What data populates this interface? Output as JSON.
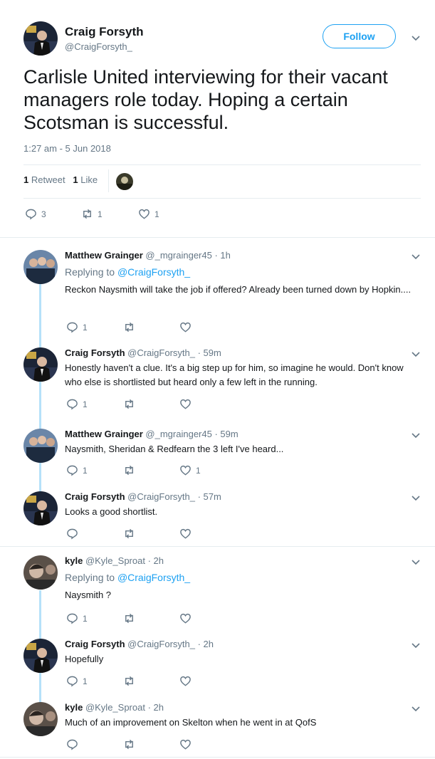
{
  "tweet": {
    "name": "Craig Forsyth",
    "handle": "@CraigForsyth_",
    "follow_label": "Follow",
    "text": "Carlisle United interviewing for their vacant managers role today. Hoping a certain Scotsman is successful.",
    "time": "1:27 am - 5 Jun 2018",
    "retweets_count": "1",
    "retweets_label": "Retweet",
    "likes_count": "1",
    "likes_label": "Like",
    "actions": {
      "replies": "3",
      "retweets": "1",
      "likes": "1"
    }
  },
  "replies": [
    {
      "name": "Matthew Grainger",
      "handle": "@_mgrainger45",
      "time": "· 1h",
      "replying_prefix": "Replying to ",
      "replying_to": "@CraigForsyth_",
      "text": "Reckon Naysmith will take the job if offered? Already been turned down by Hopkin....",
      "reply_count": "1",
      "retweet_count": "",
      "like_count": ""
    },
    {
      "name": "Craig Forsyth",
      "handle": "@CraigForsyth_",
      "time": "· 59m",
      "text": "Honestly haven't a clue. It's a big step up for him, so imagine he would. Don't know who else is shortlisted but heard only a few left in the running.",
      "reply_count": "1",
      "retweet_count": "",
      "like_count": ""
    },
    {
      "name": "Matthew Grainger",
      "handle": "@_mgrainger45",
      "time": "· 59m",
      "text": "Naysmith, Sheridan & Redfearn the 3 left I've heard...",
      "reply_count": "1",
      "retweet_count": "",
      "like_count": "1"
    },
    {
      "name": "Craig Forsyth",
      "handle": "@CraigForsyth_",
      "time": "· 57m",
      "text": "Looks a good shortlist.",
      "reply_count": "",
      "retweet_count": "",
      "like_count": ""
    },
    {
      "name": "kyle",
      "handle": "@Kyle_Sproat",
      "time": "· 2h",
      "replying_prefix": "Replying to ",
      "replying_to": "@CraigForsyth_",
      "text": "Naysmith ?",
      "reply_count": "1",
      "retweet_count": "",
      "like_count": ""
    },
    {
      "name": "Craig Forsyth",
      "handle": "@CraigForsyth_",
      "time": "· 2h",
      "text": "Hopefully",
      "reply_count": "1",
      "retweet_count": "",
      "like_count": ""
    },
    {
      "name": "kyle",
      "handle": "@Kyle_Sproat",
      "time": "· 2h",
      "text": "Much of an improvement on Skelton when he went in at QofS",
      "reply_count": "",
      "retweet_count": "",
      "like_count": ""
    }
  ],
  "colors": {
    "link": "#1da1f2",
    "muted": "#657786",
    "thread": "#b6e1f9",
    "divider": "#e6ecf0"
  },
  "icons": [
    "reply-icon",
    "retweet-icon",
    "heart-icon",
    "chevron-down-icon"
  ]
}
